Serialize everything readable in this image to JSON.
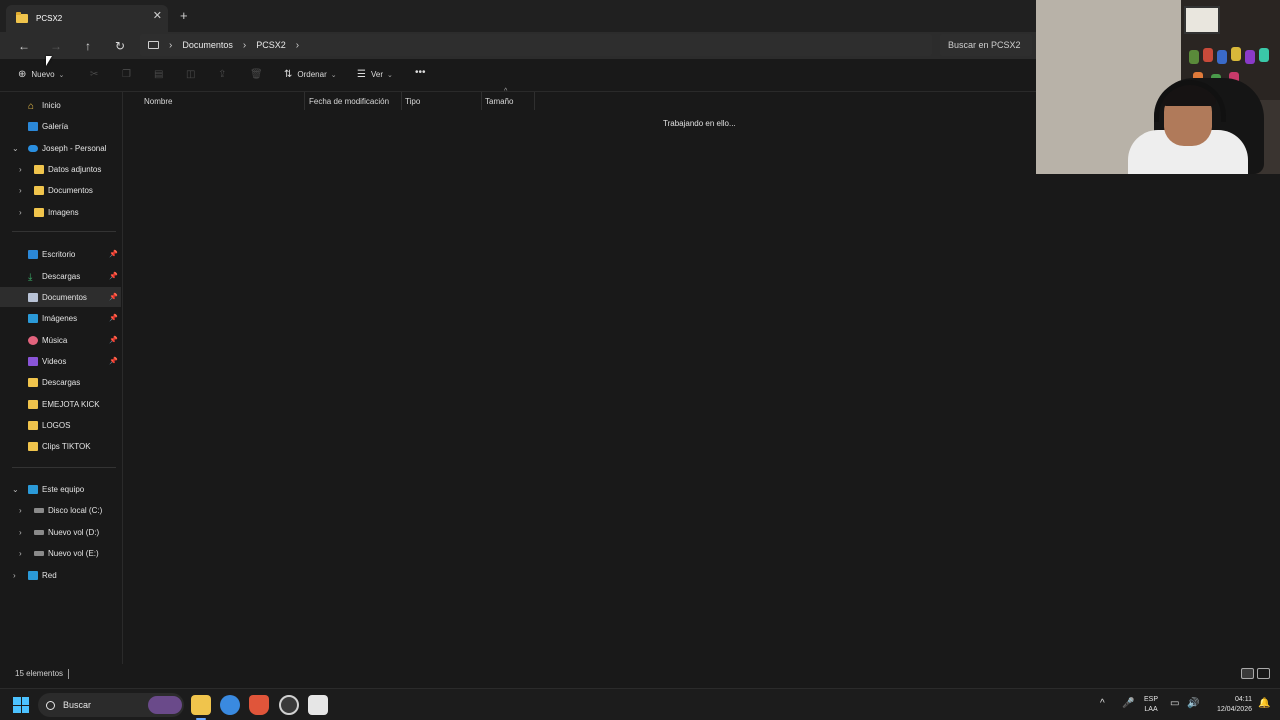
{
  "window": {
    "tab_title": "PCSX2",
    "tab_close": "✕",
    "tab_new": "+"
  },
  "nav": {
    "back": "←",
    "forward": "→",
    "up": "↑",
    "refresh": "↻",
    "breadcrumb": [
      "Documentos",
      "PCSX2"
    ],
    "search_placeholder": "Buscar en PCSX2"
  },
  "commandbar": {
    "new_label": "Nuevo",
    "sort_label": "Ordenar",
    "view_label": "Ver",
    "more": "•••"
  },
  "sidebar": {
    "items": [
      {
        "label": "Inicio",
        "icon": "home-icon"
      },
      {
        "label": "Galería",
        "icon": "gallery-icon"
      },
      {
        "label": "Joseph - Personal",
        "icon": "onedrive-icon"
      },
      {
        "label": "Datos adjuntos",
        "icon": "folder-icon"
      },
      {
        "label": "Documentos",
        "icon": "folder-icon"
      },
      {
        "label": "Imagens",
        "icon": "folder-icon"
      },
      {
        "label": "Escritorio",
        "icon": "desktop-icon"
      },
      {
        "label": "Descargas",
        "icon": "download-icon"
      },
      {
        "label": "Documentos",
        "icon": "documents-icon"
      },
      {
        "label": "Imágenes",
        "icon": "images-icon"
      },
      {
        "label": "Música",
        "icon": "music-icon"
      },
      {
        "label": "Videos",
        "icon": "videos-icon"
      },
      {
        "label": "Descargas",
        "icon": "folder-icon"
      },
      {
        "label": "EMEJOTA KICK",
        "icon": "folder-icon"
      },
      {
        "label": "LOGOS",
        "icon": "folder-icon"
      },
      {
        "label": "Clips TIKTOK",
        "icon": "folder-icon"
      },
      {
        "label": "Este equipo",
        "icon": "pc-icon"
      },
      {
        "label": "Disco local (C:)",
        "icon": "drive-icon"
      },
      {
        "label": "Nuevo vol (D:)",
        "icon": "drive-icon"
      },
      {
        "label": "Nuevo vol (E:)",
        "icon": "drive-icon"
      },
      {
        "label": "Red",
        "icon": "network-icon"
      }
    ]
  },
  "content": {
    "columns": [
      "Nombre",
      "Fecha de modificación",
      "Tipo",
      "Tamaño"
    ],
    "loading_text": "Trabajando en ello..."
  },
  "status": {
    "item_count": "15 elementos"
  },
  "taskbar": {
    "search_label": "Buscar",
    "lang_line1": "ESP",
    "lang_line2": "LAA",
    "time": "04:11",
    "date": "12/04/2026"
  },
  "colors": {
    "background": "#191919",
    "accent": "#4cc2ff",
    "folder": "#f0c44c"
  }
}
